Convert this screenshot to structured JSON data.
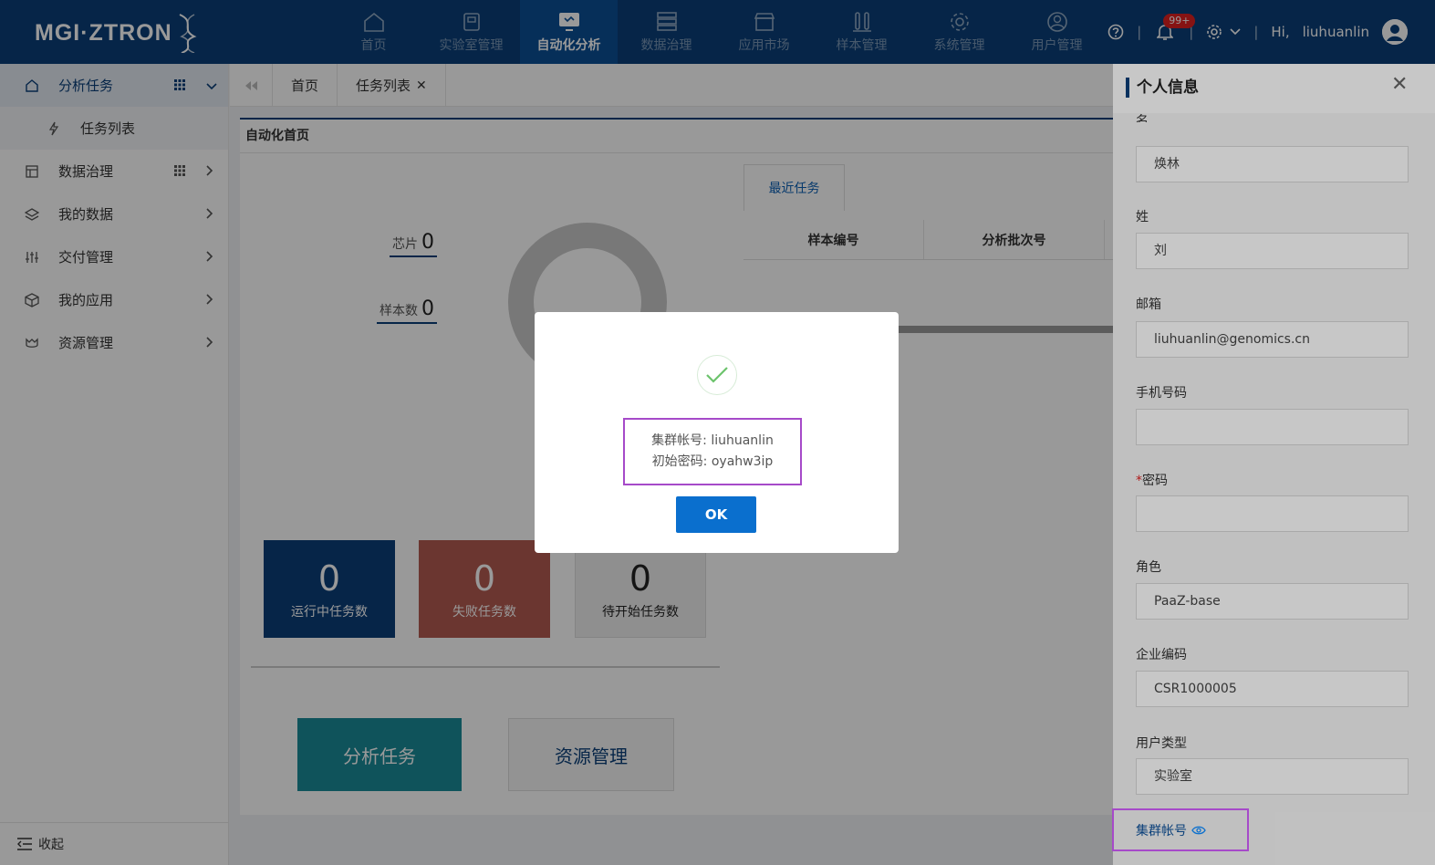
{
  "app": {
    "logo_text": "MGI·ZTRON"
  },
  "nav": [
    {
      "label": "首页",
      "icon": "home-icon"
    },
    {
      "label": "实验室管理",
      "icon": "lab-icon"
    },
    {
      "label": "自动化分析",
      "icon": "monitor-icon",
      "active": true
    },
    {
      "label": "数据治理",
      "icon": "database-icon"
    },
    {
      "label": "应用市场",
      "icon": "store-icon"
    },
    {
      "label": "样本管理",
      "icon": "tubes-icon"
    },
    {
      "label": "系统管理",
      "icon": "gear-icon"
    },
    {
      "label": "用户管理",
      "icon": "user-icon"
    }
  ],
  "header": {
    "badge": "99+",
    "greeting": "Hi,",
    "username": "liuhuanlin"
  },
  "sidebar": {
    "items": [
      {
        "label": "分析任务",
        "icon": "home-icon",
        "active": true
      },
      {
        "label": "任务列表",
        "icon": "task-icon",
        "sub": true
      },
      {
        "label": "数据治理",
        "icon": "table-icon"
      },
      {
        "label": "我的数据",
        "icon": "layers-icon"
      },
      {
        "label": "交付管理",
        "icon": "sliders-icon"
      },
      {
        "label": "我的应用",
        "icon": "cube-icon"
      },
      {
        "label": "资源管理",
        "icon": "cloud-icon"
      }
    ],
    "collapse_label": "收起"
  },
  "tabs": [
    {
      "label": "首页"
    },
    {
      "label": "任务列表",
      "closable": true
    }
  ],
  "main": {
    "title": "自动化首页",
    "chip_label": "芯片",
    "chip_value": "0",
    "sample_label": "样本数",
    "sample_value": "0",
    "recent_tab": "最近任务",
    "table_headers": [
      "样本编号",
      "分析批次号"
    ],
    "cards": [
      {
        "value": "0",
        "label": "运行中任务数",
        "color": "#0a3f79"
      },
      {
        "value": "0",
        "label": "失败任务数",
        "color": "#b25a51"
      },
      {
        "value": "0",
        "label": "待开始任务数",
        "color": "#eeeeee"
      }
    ],
    "btn_analysis": "分析任务",
    "btn_resource": "资源管理"
  },
  "panel": {
    "title": "个人信息",
    "fields": [
      {
        "label": "名",
        "value": "焕林"
      },
      {
        "label": "姓",
        "value": "刘"
      },
      {
        "label": "邮箱",
        "value": "liuhuanlin@genomics.cn"
      },
      {
        "label": "手机号码",
        "value": ""
      },
      {
        "label": "密码",
        "value": "",
        "required": true
      },
      {
        "label": "角色",
        "value": "PaaZ-base"
      },
      {
        "label": "企业编码",
        "value": "CSR1000005"
      },
      {
        "label": "用户类型",
        "value": "实验室"
      }
    ],
    "cluster_label": "集群帐号"
  },
  "modal": {
    "line1": "集群帐号: liuhuanlin",
    "line2": "初始密码: oyahw3ip",
    "ok": "OK"
  }
}
